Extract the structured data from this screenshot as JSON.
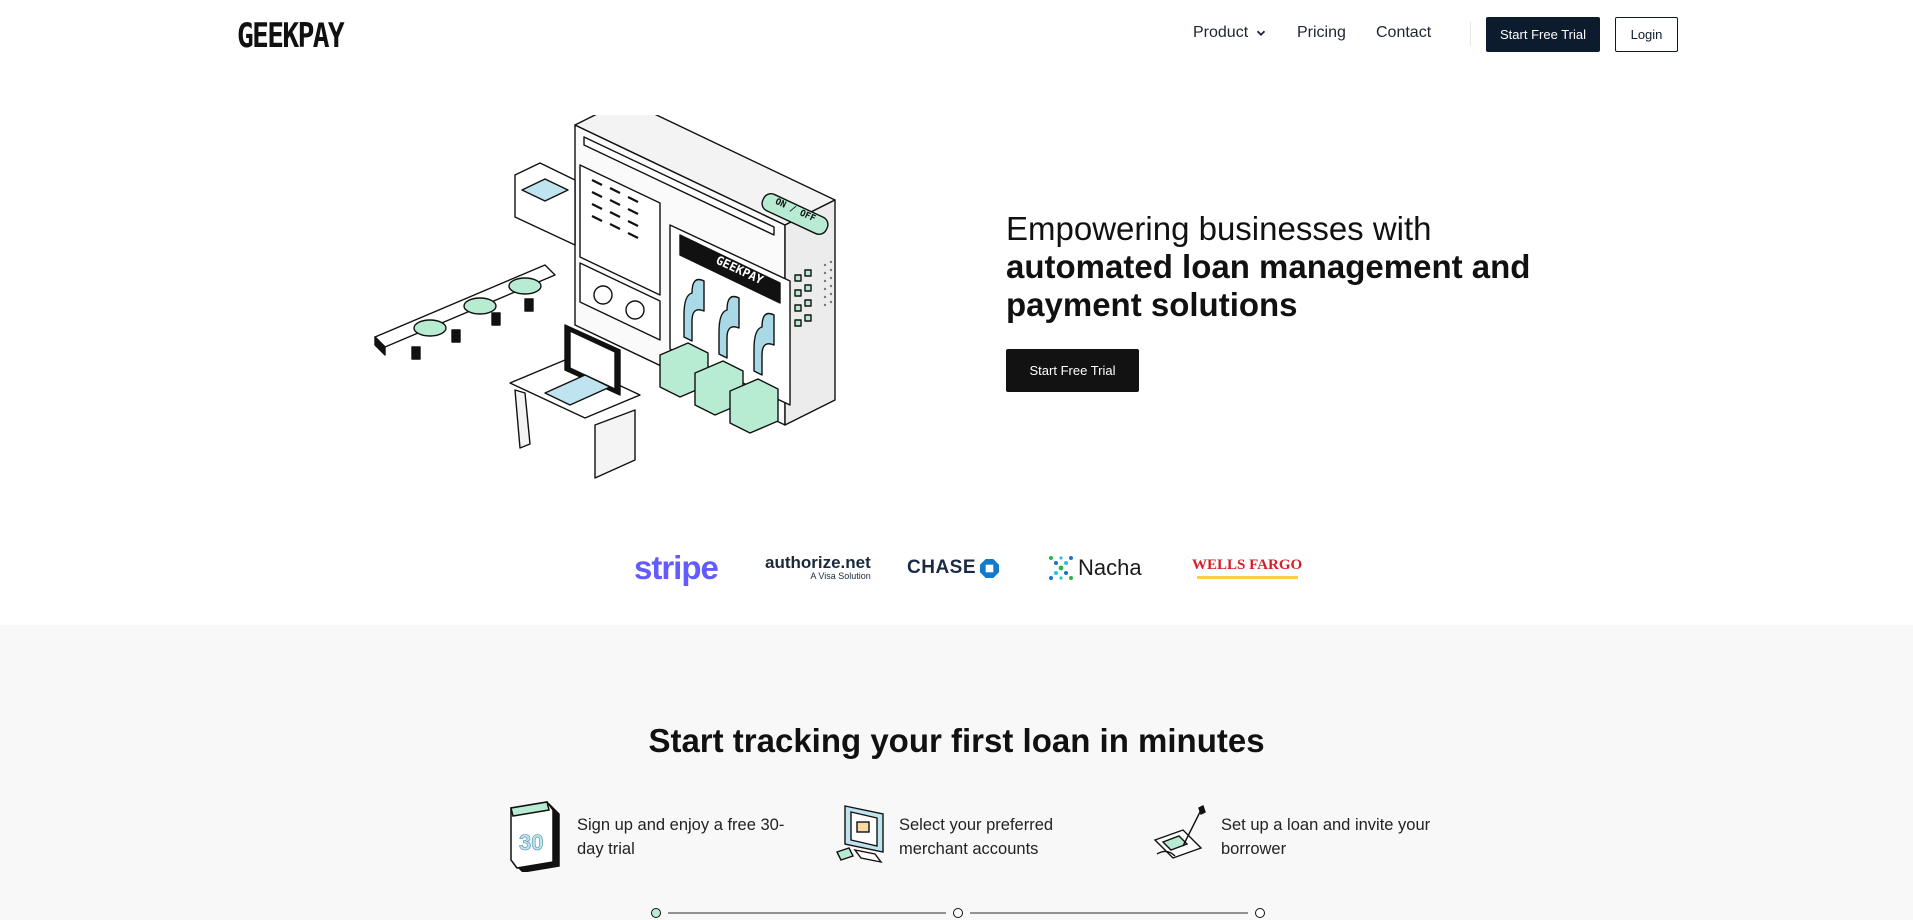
{
  "header": {
    "logo": "GEEKPAY",
    "nav": {
      "product": "Product",
      "pricing": "Pricing",
      "contact": "Contact"
    },
    "start_trial": "Start Free Trial",
    "login": "Login"
  },
  "hero": {
    "title_line1": "Empowering businesses with",
    "title_bold": "automated loan management and payment solutions",
    "cta": "Start Free Trial",
    "illustration": {
      "screen_label": "GEEKPAY",
      "switch_label": "ON / OFF"
    }
  },
  "partners": {
    "stripe": "stripe",
    "authorize": "authorize.net",
    "authorize_sub": "A Visa Solution",
    "chase": "CHASE",
    "nacha": "Nacha",
    "wells_fargo": "WELLS FARGO"
  },
  "steps_section": {
    "title": "Start tracking your first loan in minutes",
    "steps": [
      {
        "text": "Sign up and enjoy a free 30-day trial",
        "icon": "calendar-30-icon",
        "icon_label": "30"
      },
      {
        "text": "Select your preferred merchant accounts",
        "icon": "computer-merchant-icon"
      },
      {
        "text": "Set up a loan and invite your borrower",
        "icon": "pen-signature-icon"
      }
    ]
  },
  "colors": {
    "primary_dark": "#0d1b2e",
    "hero_button": "#121212",
    "accent_mint": "#b7ecd3",
    "section_bg": "#f8f8f8"
  }
}
